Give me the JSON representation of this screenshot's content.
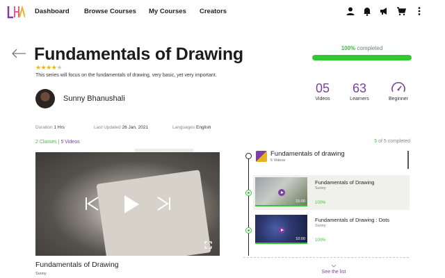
{
  "nav": {
    "logo_text": "LHA",
    "links": [
      "Dashboard",
      "Browse Courses",
      "My Courses",
      "Creators"
    ],
    "icons": [
      "user-icon",
      "bell-icon",
      "megaphone-icon",
      "cart-icon",
      "more-vertical-icon"
    ]
  },
  "course": {
    "title": "Fundamentals of Drawing",
    "rating": 4,
    "rating_max": 5,
    "subtitle": "This series will focus on the fundamentals of drawing, very basic, yet very important.",
    "instructor": "Sunny Bhanushali",
    "duration_label": "Duration",
    "duration_value": "1 Hrs",
    "updated_label": "Last Updated",
    "updated_value": "26 Jan, 2021",
    "language_label": "Languages",
    "language_value": "English",
    "classes_text": "2 Classes",
    "separator": "|",
    "videos_text": "5 Videos"
  },
  "progress": {
    "value": "100%",
    "label": "completed",
    "fraction": 1.0
  },
  "stats": {
    "videos_num": "05",
    "videos_label": "Videos",
    "learners_num": "63",
    "learners_label": "Learners",
    "level_label": "Beginner"
  },
  "player": {
    "title": "Fundamentals of Drawing",
    "author": "Sunny"
  },
  "playlist": {
    "completed_count": "5",
    "completed_of": "of 5",
    "completed_label": "completed",
    "section_title": "Fundamentals of drawing",
    "section_sub": "5 Videos",
    "items": [
      {
        "title": "Fundamentals of Drawing",
        "author": "Sunny",
        "duration": "15:00",
        "progress": "100%"
      },
      {
        "title": "Fundamentals of Drawing : Dots",
        "author": "Sunny",
        "duration": "10:00",
        "progress": "100%"
      }
    ],
    "see_list": "See the list"
  },
  "colors": {
    "accent": "#7b3fa0",
    "success": "#2ec92e",
    "star": "#e6b422"
  }
}
